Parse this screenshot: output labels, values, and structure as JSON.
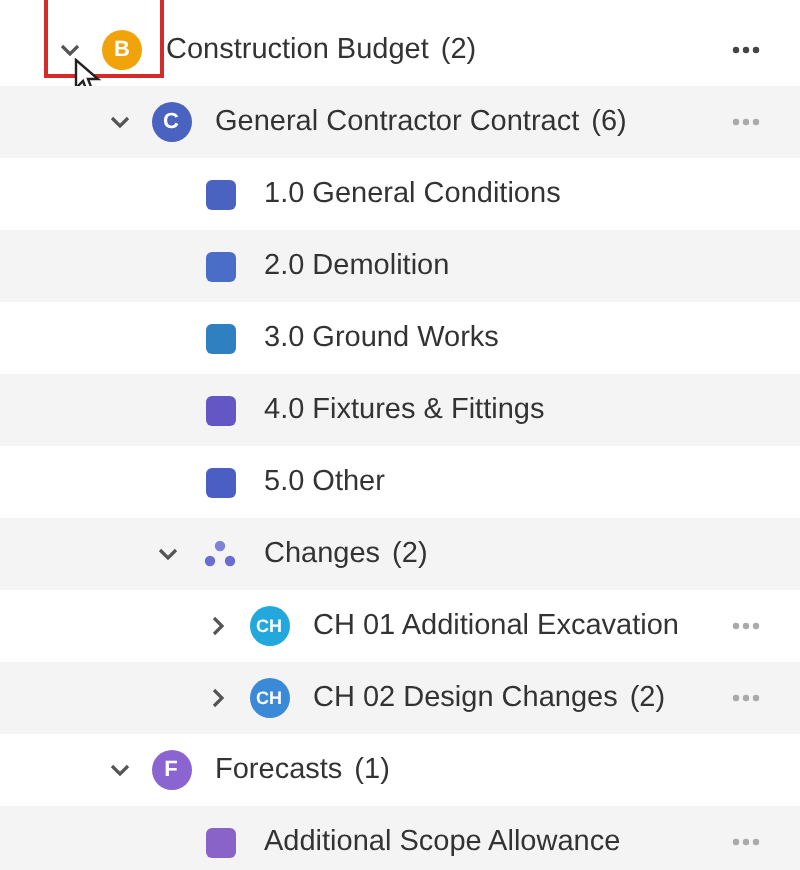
{
  "tree": [
    {
      "label": "Construction Budget",
      "count": "(2)",
      "expanded": true,
      "annotated": true,
      "hovered": true,
      "actions": true,
      "icon": {
        "kind": "badge",
        "text": "B",
        "color": "#f0a30a"
      },
      "children": [
        {
          "label": "General Contractor Contract",
          "count": "(6)",
          "expanded": true,
          "hovered": false,
          "actions": true,
          "icon": {
            "kind": "badge",
            "text": "C",
            "color": "#4a62c0"
          },
          "children": [
            {
              "label": "1.0 General Conditions",
              "icon": {
                "kind": "square",
                "color": "#4a62c0"
              }
            },
            {
              "label": "2.0 Demolition",
              "icon": {
                "kind": "square",
                "color": "#4a6ec8"
              }
            },
            {
              "label": "3.0 Ground Works",
              "icon": {
                "kind": "square",
                "color": "#2f80c0"
              }
            },
            {
              "label": "4.0 Fixtures & Fittings",
              "icon": {
                "kind": "square",
                "color": "#6456c4"
              }
            },
            {
              "label": "5.0 Other",
              "icon": {
                "kind": "square",
                "color": "#4a5ec4"
              }
            },
            {
              "label": "Changes",
              "count": "(2)",
              "expanded": true,
              "icon": {
                "kind": "cluster",
                "color": "#6a6ed0"
              },
              "children": [
                {
                  "label": "CH 01 Additional Excavation",
                  "expanded": false,
                  "hovered": false,
                  "actions": true,
                  "icon": {
                    "kind": "badge",
                    "text": "CH",
                    "color": "#22a8dc"
                  }
                },
                {
                  "label": "CH 02 Design Changes",
                  "count": "(2)",
                  "expanded": false,
                  "hovered": false,
                  "actions": true,
                  "icon": {
                    "kind": "badge",
                    "text": "CH",
                    "color": "#3a8ad8"
                  }
                }
              ]
            }
          ]
        },
        {
          "label": "Forecasts",
          "count": "(1)",
          "expanded": true,
          "icon": {
            "kind": "badge",
            "text": "F",
            "color": "#8a64d0"
          },
          "children": [
            {
              "label": "Additional Scope Allowance",
              "hovered": false,
              "actions": true,
              "icon": {
                "kind": "square",
                "color": "#8a63c9"
              }
            }
          ]
        }
      ]
    }
  ]
}
